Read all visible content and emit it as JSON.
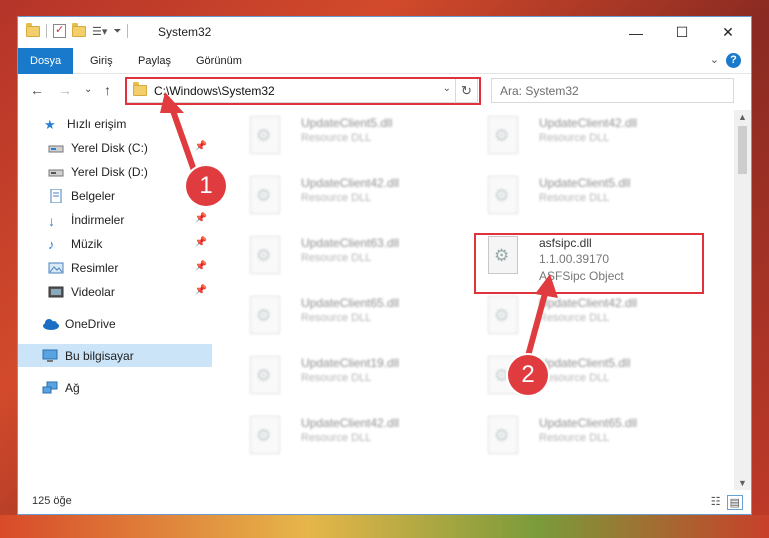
{
  "window": {
    "title": "System32",
    "min_glyph": "—",
    "max_glyph": "☐",
    "close_glyph": "✕"
  },
  "ribbon": {
    "tabs": [
      {
        "label": "Dosya",
        "active": true
      },
      {
        "label": "Giriş",
        "active": false
      },
      {
        "label": "Paylaş",
        "active": false
      },
      {
        "label": "Görünüm",
        "active": false
      }
    ],
    "help": "?",
    "expand": "⌄"
  },
  "nav": {
    "back": "←",
    "forward": "→",
    "recent": "⌄",
    "up": "↑",
    "address": "C:\\Windows\\System32",
    "address_dropdown": "⌄",
    "refresh": "↻",
    "search_placeholder": "Ara: System32"
  },
  "sidebar": {
    "items": [
      {
        "label": "Hızlı erişim",
        "icon": "star-icon"
      },
      {
        "label": "Yerel Disk (C:)",
        "icon": "drive-icon",
        "pinned": true
      },
      {
        "label": "Yerel Disk (D:)",
        "icon": "drive-icon",
        "pinned": true
      },
      {
        "label": "Belgeler",
        "icon": "documents-icon",
        "pinned": true
      },
      {
        "label": "İndirmeler",
        "icon": "download-icon",
        "pinned": true
      },
      {
        "label": "Müzik",
        "icon": "music-icon",
        "pinned": true
      },
      {
        "label": "Resimler",
        "icon": "pictures-icon",
        "pinned": true
      },
      {
        "label": "Videolar",
        "icon": "videos-icon",
        "pinned": true
      },
      {
        "label": "OneDrive",
        "icon": "cloud-icon"
      },
      {
        "label": "Bu bilgisayar",
        "icon": "computer-icon",
        "selected": true
      },
      {
        "label": "Ağ",
        "icon": "network-icon"
      }
    ],
    "pin_glyph": "📌"
  },
  "files": [
    {
      "name": "UpdateClient5.dll",
      "desc": "Resource DLL"
    },
    {
      "name": "UpdateClient42.dll",
      "desc": "Resource DLL"
    },
    {
      "name": "UpdateClient42.dll",
      "desc": "Resource DLL"
    },
    {
      "name": "UpdateClient5.dll",
      "desc": "Resource DLL"
    },
    {
      "name": "UpdateClient63.dll",
      "desc": "Resource DLL"
    },
    {
      "name": "asfsipc.dll",
      "desc": "1.1.00.39170",
      "desc2": "ASFSipc Object",
      "highlighted": true
    },
    {
      "name": "UpdateClient65.dll",
      "desc": "Resource DLL"
    },
    {
      "name": "UpdateClient42.dll",
      "desc": "Resource DLL"
    },
    {
      "name": "UpdateClient19.dll",
      "desc": "Resource DLL"
    },
    {
      "name": "UpdateClient5.dll",
      "desc": "Resource DLL"
    },
    {
      "name": "UpdateClient42.dll",
      "desc": "Resource DLL"
    },
    {
      "name": "UpdateClient65.dll",
      "desc": "Resource DLL"
    }
  ],
  "status": {
    "count": "125 öğe"
  },
  "annotations": {
    "step1": "1",
    "step2": "2",
    "color": "#e03b3f"
  }
}
